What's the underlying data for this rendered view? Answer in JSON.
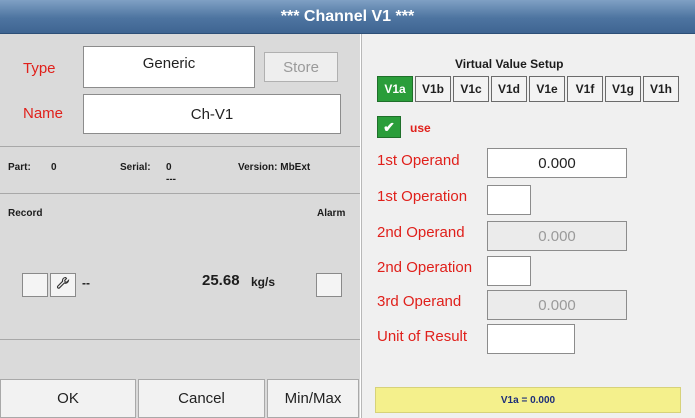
{
  "window": {
    "title": "*** Channel V1 ***"
  },
  "left": {
    "type_label": "Type",
    "type_value": "Generic",
    "store_label": "Store",
    "name_label": "Name",
    "name_value": "Ch-V1",
    "part_label": "Part:",
    "part_value": "0",
    "serial_label": "Serial:",
    "serial_value": "0",
    "serial_sub": "---",
    "version_label": "Version: MbExt",
    "record_label": "Record",
    "alarm_label": "Alarm",
    "reading_prefix": "--",
    "reading_value": "25.68",
    "reading_unit": "kg/s"
  },
  "bottom": {
    "ok_label": "OK",
    "cancel_label": "Cancel",
    "minmax_label": "Min/Max"
  },
  "right": {
    "section_title": "Virtual Value Setup",
    "tabs": [
      "V1a",
      "V1b",
      "V1c",
      "V1d",
      "V1e",
      "V1f",
      "V1g",
      "V1h"
    ],
    "active_tab": "V1a",
    "use_label": "use",
    "fields": {
      "op1_label": "1st Operand",
      "op1_value": "0.000",
      "oper1_label": "1st Operation",
      "op2_label": "2nd Operand",
      "op2_value": "0.000",
      "oper2_label": "2nd Operation",
      "op3_label": "3rd Operand",
      "op3_value": "0.000",
      "unit_label": "Unit of Result"
    },
    "result_text": "V1a = 0.000"
  },
  "colors": {
    "title_bar": "#4d74a0",
    "active_tab": "#2a9d3a",
    "label_red": "#e0201b",
    "result_bg": "#f4f08c"
  },
  "icons": {
    "wrench": "wrench-icon",
    "check": "checkmark-icon"
  }
}
